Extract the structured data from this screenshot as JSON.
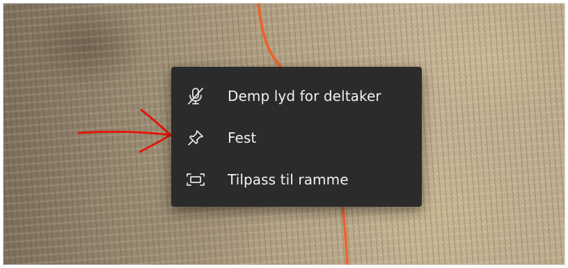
{
  "context_menu": {
    "items": [
      {
        "label": "Demp lyd for deltaker",
        "icon": "mic-off-icon"
      },
      {
        "label": "Fest",
        "icon": "pin-icon"
      },
      {
        "label": "Tilpass til ramme",
        "icon": "fit-to-frame-icon"
      }
    ]
  },
  "colors": {
    "menu_background": "#2b2b2b",
    "menu_text": "#f2f2f2",
    "icon_stroke": "#e6e6e6",
    "annotation_arrow": "#e3170a",
    "cable": "#f0602a"
  }
}
